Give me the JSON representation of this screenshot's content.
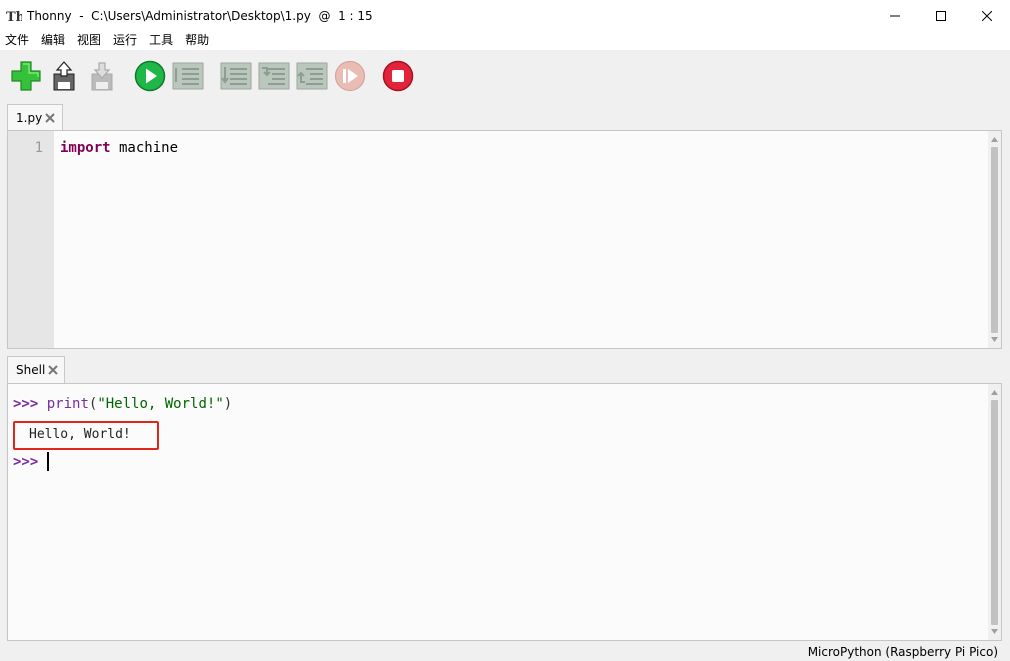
{
  "window": {
    "app_name": "Thonny",
    "title": "Thonny  -  C:\\Users\\Administrator\\Desktop\\1.py  @  1 : 15"
  },
  "menu": {
    "items": [
      "文件",
      "编辑",
      "视图",
      "运行",
      "工具",
      "帮助"
    ]
  },
  "toolbar": {
    "buttons": [
      {
        "name": "new-file",
        "icon": "green-plus-icon",
        "enabled": true
      },
      {
        "name": "open-file",
        "icon": "upload-disk-icon",
        "enabled": true
      },
      {
        "name": "save-file",
        "icon": "download-disk-icon",
        "enabled": false
      },
      {
        "name": "run",
        "icon": "play-icon",
        "enabled": true
      },
      {
        "name": "debug",
        "icon": "debug-icon",
        "enabled": false
      },
      {
        "name": "step-over",
        "icon": "step-over-icon",
        "enabled": false
      },
      {
        "name": "step-into",
        "icon": "step-into-icon",
        "enabled": false
      },
      {
        "name": "step-out",
        "icon": "step-out-icon",
        "enabled": false
      },
      {
        "name": "resume",
        "icon": "resume-icon",
        "enabled": false
      },
      {
        "name": "stop",
        "icon": "stop-icon",
        "enabled": true
      }
    ]
  },
  "editor": {
    "tab_label": "1.py",
    "lines": [
      {
        "number": "1",
        "keyword": "import",
        "rest": " machine"
      }
    ]
  },
  "shell": {
    "tab_label": "Shell",
    "prompt": ">>>",
    "command_fn": "print",
    "command_open": "(",
    "command_string": "\"Hello, World!\"",
    "command_close": ")",
    "output": "Hello, World!",
    "current_prompt": ">>>"
  },
  "status": {
    "interpreter": "MicroPython (Raspberry Pi Pico)"
  },
  "colors": {
    "keyword": "#7f0055",
    "prompt": "#7b2b9c",
    "string": "#006400",
    "highlight_box": "#e1261c",
    "run_green": "#1fb848",
    "stop_red": "#e2233a"
  }
}
